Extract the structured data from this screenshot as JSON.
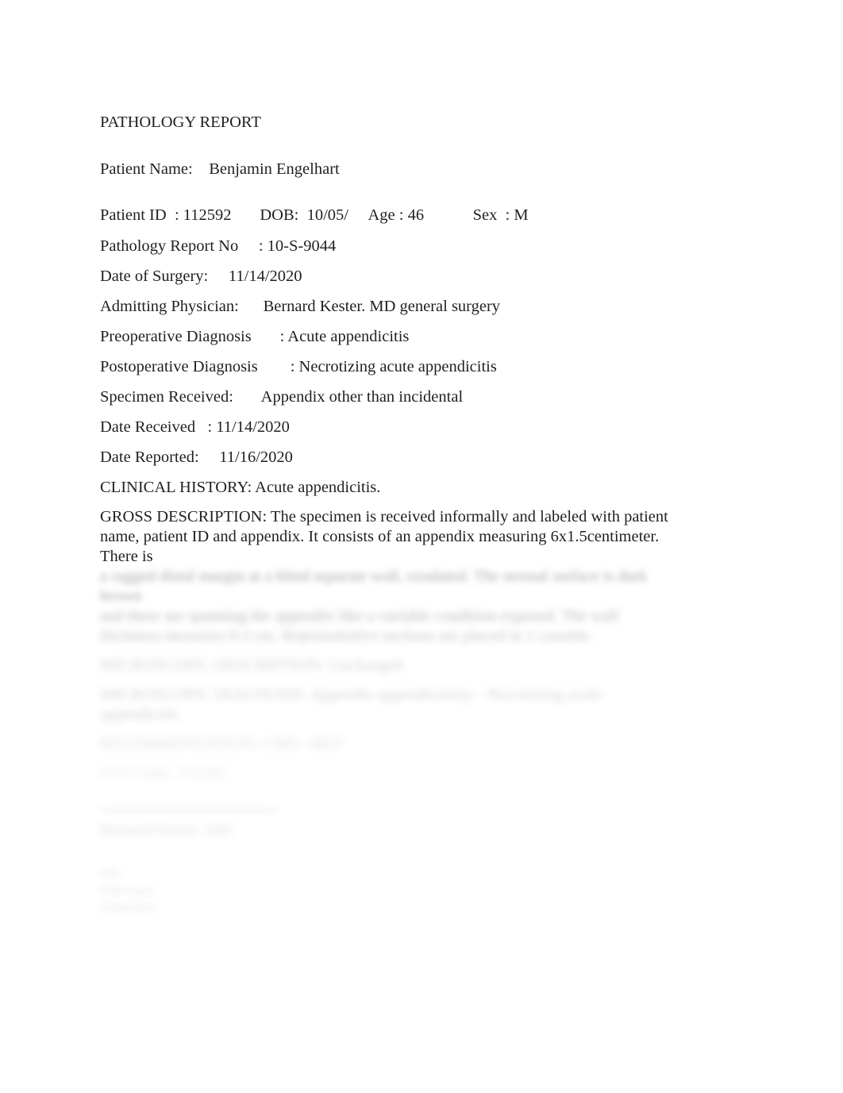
{
  "document": {
    "title": "PATHOLOGY REPORT",
    "background_color": "#ffffff",
    "text_color": "#231f20"
  },
  "header": {
    "patient_name_label": "Patient Name:",
    "patient_name_value": "Benjamin Engelhart",
    "patient_name_line": "Patient Name:    Benjamin Engelhart"
  },
  "identifiers": {
    "patient_id_line": "Patient ID  : 112592       DOB:  10/05/     Age : 46            Sex  : M",
    "patient_id_label": "Patient ID",
    "patient_id_value": "112592",
    "dob_label": "DOB:",
    "dob_value": "10/05/",
    "age_label": "Age :",
    "age_value": "46",
    "sex_label": "Sex  :",
    "sex_value": "M",
    "report_no_line": "Pathology Report No     : 10-S-9044",
    "report_no_label": "Pathology Report No",
    "report_no_value": "10-S-9044"
  },
  "details": {
    "date_of_surgery_line": "Date of Surgery:     11/14/2020",
    "date_of_surgery_label": "Date of Surgery:",
    "date_of_surgery_value": "11/14/2020",
    "admitting_physician_line": "Admitting Physician:      Bernard Kester. MD general surgery",
    "admitting_physician_label": "Admitting Physician:",
    "admitting_physician_value": "Bernard Kester. MD general surgery",
    "preoperative_diagnosis_line": "Preoperative Diagnosis       : Acute appendicitis",
    "preoperative_diagnosis_label": "Preoperative Diagnosis",
    "preoperative_diagnosis_value": "Acute appendicitis",
    "postoperative_diagnosis_line": "Postoperative Diagnosis        : Necrotizing acute appendicitis",
    "postoperative_diagnosis_label": "Postoperative Diagnosis",
    "postoperative_diagnosis_value": "Necrotizing acute appendicitis",
    "specimen_received_line": "Specimen Received:       Appendix other than incidental",
    "specimen_received_label": "Specimen Received:",
    "specimen_received_value": "Appendix other than incidental",
    "date_received_line": "Date Received   : 11/14/2020",
    "date_received_label": "Date Received",
    "date_received_value": "11/14/2020",
    "date_reported_line": "Date Reported:     11/16/2020",
    "date_reported_label": "Date Reported:",
    "date_reported_value": "11/16/2020"
  },
  "sections": {
    "clinical_history": "CLINICAL HISTORY: Acute appendicitis.",
    "gross_description": "GROSS DESCRIPTION: The specimen is received informally and labeled with patient name, patient ID and appendix. It consists of an appendix measuring 6x1.5centimeter. There is"
  },
  "redacted": {
    "note": "Lower portion of the report is blurred and illegible in the screenshot.",
    "gross_description_continued_1": "a ragged distal margin at a blind separate wall, exudated. The serosal surface is dark brown",
    "gross_description_continued_2": "and there are spanning the appendix like a variable condition exposed. The wall",
    "gross_description_continued_3": "thickness measures 0.3 cm. Representative sections are placed in 1 cassette.",
    "microscopic_description_line": "MICROSCOPIC DESCRIPTION: Unchanged",
    "microscopic_diagnosis_line": "MICROSCOPIC DIAGNOSIS: Appendix appendectomy - Necrotizing acute appendicitis",
    "recommendation_line": "RECOMMENDATION: CMS - BKT",
    "footer_line": "CPT Code: 114589",
    "signature_name_line": "Bernard Kester. MD",
    "signature_block_1": "MD",
    "signature_block_2": "Pathologist",
    "signature_block_3": "Department"
  }
}
